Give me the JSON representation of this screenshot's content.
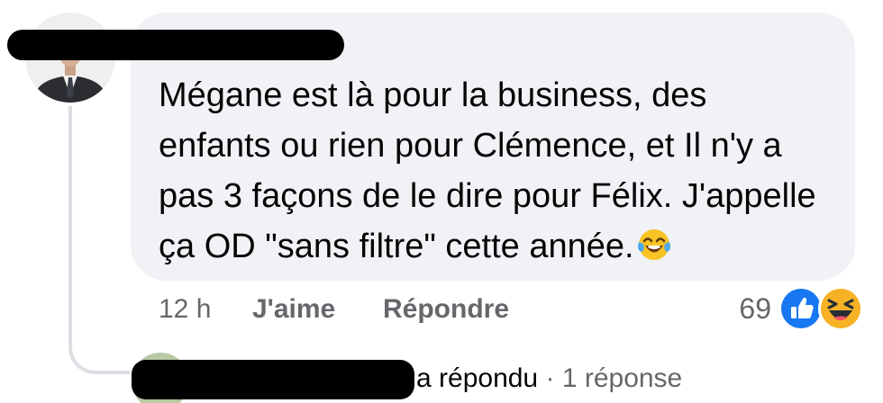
{
  "comment": {
    "text_lines": [
      "Mégane est là pour la business, des",
      "enfants ou rien pour Clémence, et Il n'y a",
      "pas 3 façons de le dire pour Félix. J'appelle",
      "ça OD \"sans filtre\" cette année."
    ],
    "emoji": "face-with-tears-of-joy-icon",
    "time": "12 h",
    "like_label": "J'aime",
    "reply_label": "Répondre",
    "reaction_count": "69",
    "reactions": [
      "like-icon",
      "haha-icon"
    ]
  },
  "reply_summary": {
    "verb": "a répondu",
    "separator": "·",
    "count_text": "1 réponse"
  },
  "colors": {
    "bubble": "#f0f2f5",
    "meta_text": "#65676b",
    "like_blue": "#1877f2",
    "haha_yellow": "#f7b125",
    "thread_line": "#dcdfe3",
    "redaction": "#000000"
  }
}
